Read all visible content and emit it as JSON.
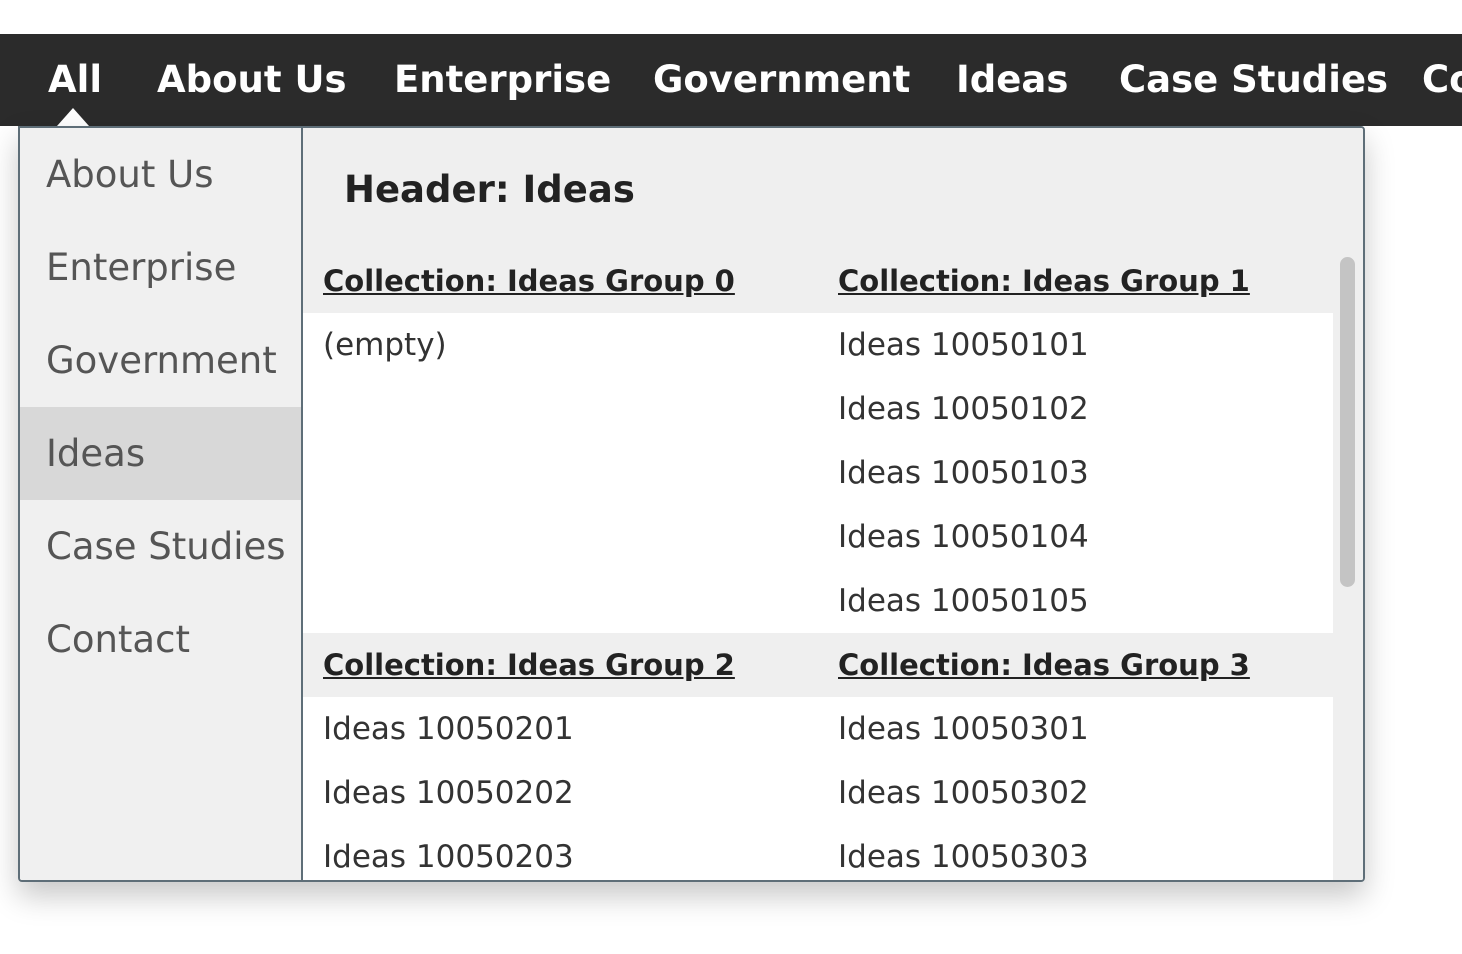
{
  "topnav": {
    "items": [
      "All",
      "About Us",
      "Enterprise",
      "Government",
      "Ideas",
      "Case Studies",
      "Contact"
    ],
    "active": "All"
  },
  "sidebar": {
    "items": [
      "About Us",
      "Enterprise",
      "Government",
      "Ideas",
      "Case Studies",
      "Contact"
    ],
    "selected": "Ideas"
  },
  "panel": {
    "header": "Header: Ideas",
    "groups": [
      {
        "title": "Collection: Ideas Group 0",
        "items": [
          "(empty)"
        ]
      },
      {
        "title": "Collection: Ideas Group 1",
        "items": [
          "Ideas 10050101",
          "Ideas 10050102",
          "Ideas 10050103",
          "Ideas 10050104",
          "Ideas 10050105"
        ]
      },
      {
        "title": "Collection: Ideas Group 2",
        "items": [
          "Ideas 10050201",
          "Ideas 10050202",
          "Ideas 10050203"
        ]
      },
      {
        "title": "Collection: Ideas Group 3",
        "items": [
          "Ideas 10050301",
          "Ideas 10050302",
          "Ideas 10050303"
        ]
      }
    ]
  },
  "colors": {
    "nav_background": "#2b2b2b",
    "panel_border": "#5e6e78",
    "selected_background": "#d8d8d8"
  }
}
